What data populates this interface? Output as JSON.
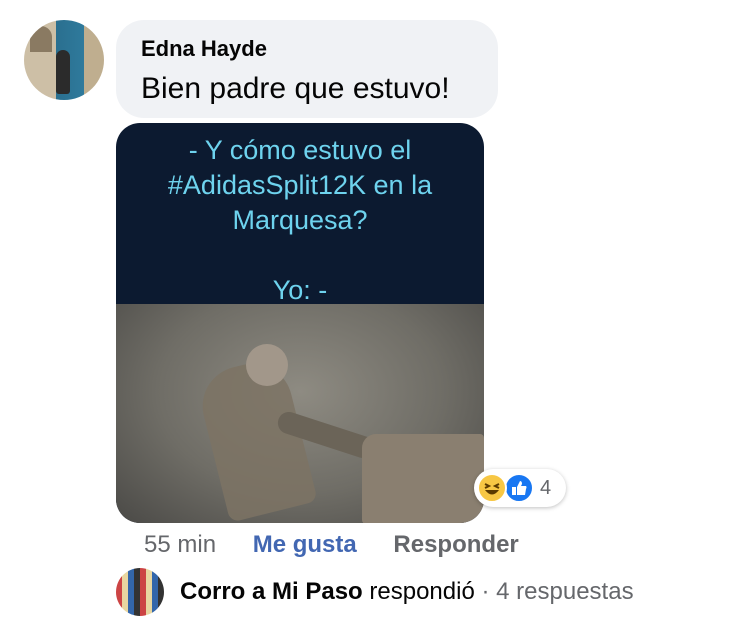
{
  "comment": {
    "author": "Edna Hayde",
    "text": "Bien padre que estuvo!"
  },
  "meme": {
    "lines": [
      "- Y cómo estuvo el",
      "#AdidasSplit12K en la",
      "Marquesa?",
      "",
      "Yo: -"
    ]
  },
  "reactions": {
    "count": "4",
    "icons": [
      "haha-emoji",
      "like-thumb"
    ]
  },
  "actions": {
    "time": "55 min",
    "like": "Me gusta",
    "reply": "Responder"
  },
  "reply_summary": {
    "author": "Corro a Mi Paso",
    "verb": "respondió",
    "separator": "·",
    "count_text": "4 respuestas"
  },
  "colors": {
    "link_blue": "#4267b2",
    "meme_text": "#6ed3ee",
    "meme_bg": "#0c1a30"
  }
}
